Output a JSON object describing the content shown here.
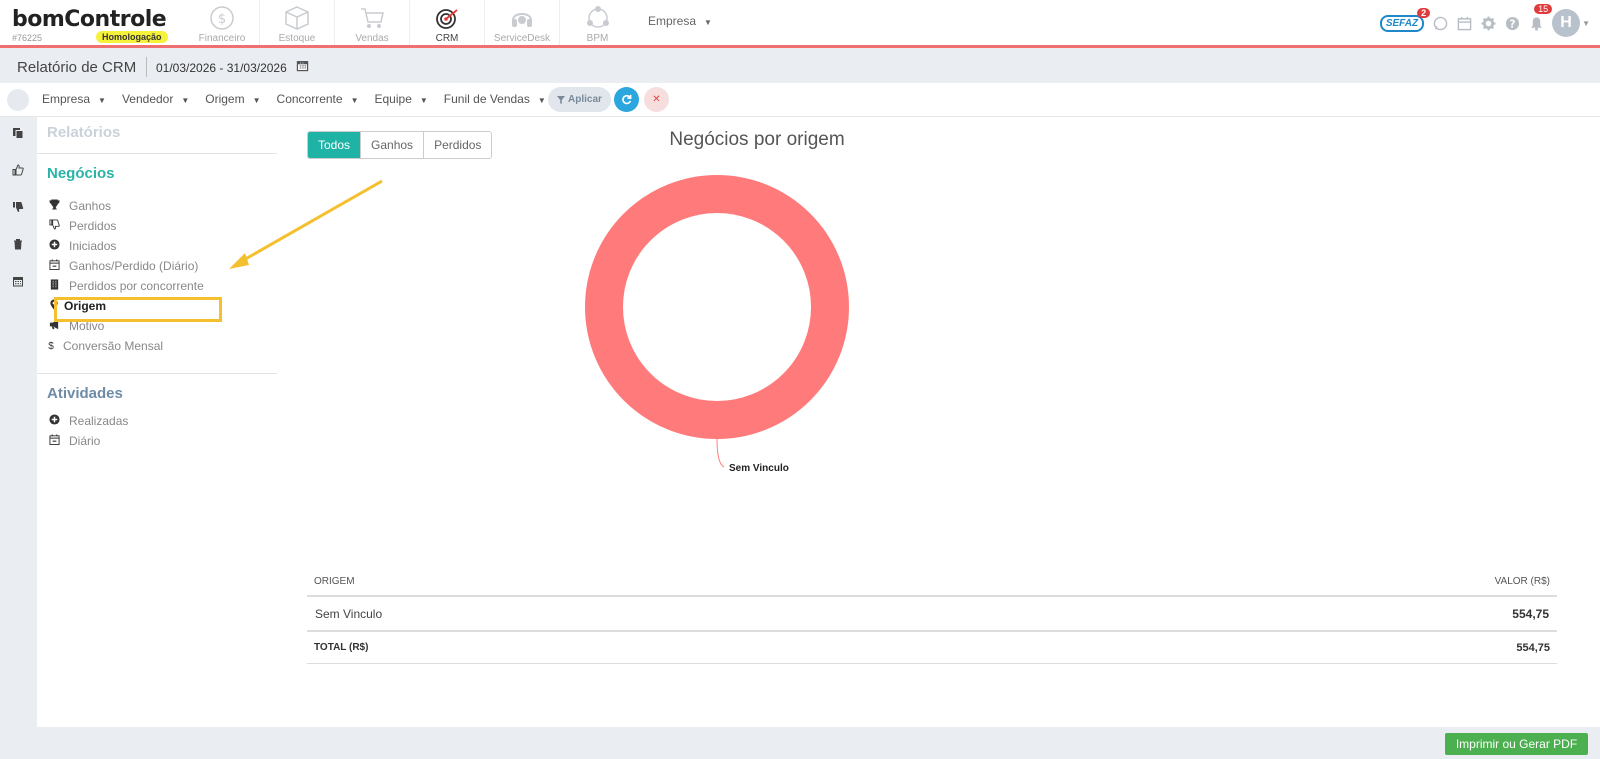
{
  "app": {
    "logo": "bomControle",
    "company_id": "#76225",
    "environment_badge": "Homologação"
  },
  "modules": [
    {
      "label": "Financeiro",
      "icon": "dollar-coin-icon",
      "active": false
    },
    {
      "label": "Estoque",
      "icon": "box-icon",
      "active": false
    },
    {
      "label": "Vendas",
      "icon": "cart-icon",
      "active": false
    },
    {
      "label": "CRM",
      "icon": "target-icon",
      "active": true
    },
    {
      "label": "ServiceDesk",
      "icon": "headset-icon",
      "active": false
    },
    {
      "label": "BPM",
      "icon": "process-cycle-icon",
      "active": false
    }
  ],
  "top_company_selector": "Empresa",
  "topbar_right": {
    "sefaz_label": "SEFAZ",
    "sefaz_count": "2",
    "notifications_count": "15",
    "avatar_initial": "H"
  },
  "page": {
    "title": "Relatório de CRM",
    "date_range": "01/03/2026 - 31/03/2026"
  },
  "filters": [
    "Empresa",
    "Vendedor",
    "Origem",
    "Concorrente",
    "Equipe",
    "Funil de Vendas"
  ],
  "filter_apply_label": "Aplicar",
  "menu": {
    "reports_heading": "Relatórios",
    "deals_heading": "Negócios",
    "deals_items": [
      {
        "label": "Ganhos",
        "icon": "trophy-icon"
      },
      {
        "label": "Perdidos",
        "icon": "thumbs-down-icon"
      },
      {
        "label": "Iniciados",
        "icon": "plus-circle-icon"
      },
      {
        "label": "Ganhos/Perdido (Diário)",
        "icon": "calendar-minus-icon"
      },
      {
        "label": "Perdidos por concorrente",
        "icon": "building-icon"
      },
      {
        "label": "Origem",
        "icon": "map-marker-icon"
      },
      {
        "label": "Motivo",
        "icon": "bullhorn-icon"
      },
      {
        "label": "Conversão Mensal",
        "icon": "dollar-icon"
      }
    ],
    "activities_heading": "Atividades",
    "activities_items": [
      {
        "label": "Realizadas",
        "icon": "plus-circle-icon"
      },
      {
        "label": "Diário",
        "icon": "calendar-minus-icon"
      }
    ]
  },
  "tabs": [
    "Todos",
    "Ganhos",
    "Perdidos"
  ],
  "chart_data": {
    "type": "pie",
    "title": "Negócios por origem",
    "categories": [
      "Sem Vinculo"
    ],
    "values": [
      554.75
    ],
    "colors": [
      "#ff7b7b"
    ],
    "donut": true
  },
  "table": {
    "col_origin": "ORIGEM",
    "col_value": "VALOR (R$)",
    "rows": [
      {
        "origin": "Sem Vinculo",
        "value": "554,75"
      }
    ],
    "total_label": "TOTAL (R$)",
    "total_value": "554,75"
  },
  "print_button": "Imprimir ou Gerar PDF"
}
